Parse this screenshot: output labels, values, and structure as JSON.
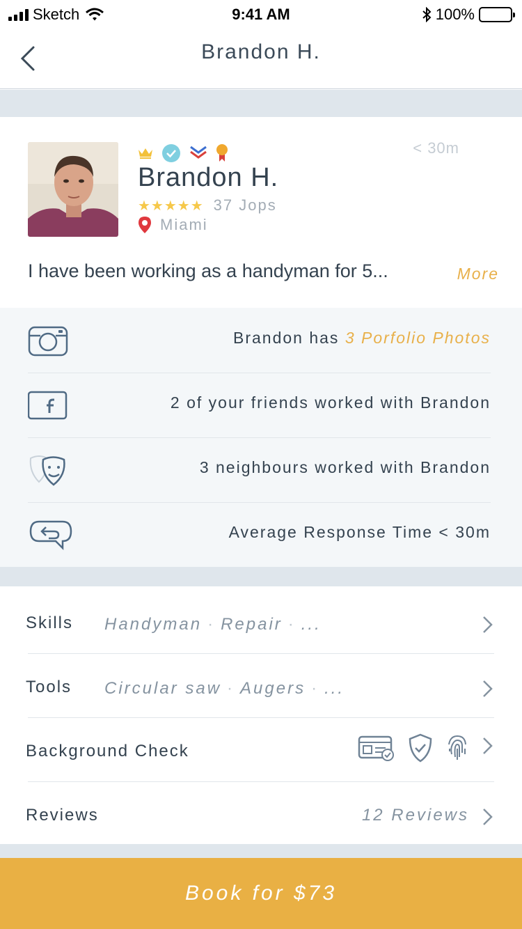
{
  "status_bar": {
    "carrier": "Sketch",
    "time": "9:41 AM",
    "battery": "100%"
  },
  "nav": {
    "title": "Brandon H."
  },
  "profile": {
    "name": "Brandon H.",
    "response_time": "< 30m",
    "stars": "★★★★★",
    "jobs": "37 Jops",
    "location": "Miami",
    "bio": "I have been working as a handyman for 5...",
    "more_label": "More",
    "badges": [
      "crown-icon",
      "verified-icon",
      "chevron-badge-icon",
      "medal-icon"
    ]
  },
  "stats": {
    "portfolio_prefix": "Brandon has ",
    "portfolio_link": "3 Porfolio Photos",
    "friends": "2 of your friends worked with Brandon",
    "neighbours": "3 neighbours worked with Brandon",
    "response": "Average Response Time < 30m"
  },
  "details": {
    "skills_label": "Skills",
    "skills_items": [
      "Handyman",
      "Repair",
      "..."
    ],
    "tools_label": "Tools",
    "tools_items": [
      "Circular saw",
      "Augers",
      "..."
    ],
    "background_label": "Background Check",
    "reviews_label": "Reviews",
    "reviews_count": "12 Reviews"
  },
  "book_button": {
    "label": "Book for $73"
  },
  "colors": {
    "accent": "#e9b044",
    "text": "#34424f",
    "muted": "#8593a0",
    "band": "#dfe6ec"
  }
}
